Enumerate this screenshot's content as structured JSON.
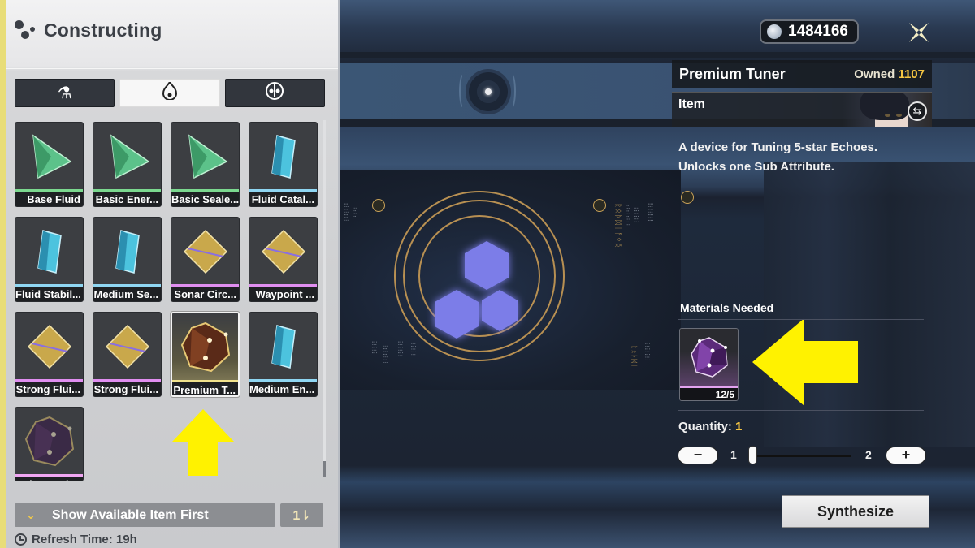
{
  "panel": {
    "title": "Constructing",
    "tabs": [
      {
        "icon": "flask-icon",
        "glyph": "⚗",
        "active": false
      },
      {
        "icon": "flame-icon",
        "glyph": "♨",
        "active": true
      },
      {
        "icon": "echo-mask-icon",
        "glyph": "◉",
        "active": false
      }
    ],
    "items": [
      {
        "name": "Base Fluid",
        "rarity": "green",
        "rarity_color": "#7bd88f"
      },
      {
        "name": "Basic Ener...",
        "rarity": "green",
        "rarity_color": "#7bd88f"
      },
      {
        "name": "Basic Seale...",
        "rarity": "green",
        "rarity_color": "#7bd88f"
      },
      {
        "name": "Fluid Catal...",
        "rarity": "blue",
        "rarity_color": "#8fd6f2"
      },
      {
        "name": "Fluid Stabil...",
        "rarity": "blue",
        "rarity_color": "#8fd6f2"
      },
      {
        "name": "Medium Se...",
        "rarity": "blue",
        "rarity_color": "#8fd6f2"
      },
      {
        "name": "Sonar Circ...",
        "rarity": "purple",
        "rarity_color": "#e08ef0"
      },
      {
        "name": "Waypoint ...",
        "rarity": "purple",
        "rarity_color": "#e08ef0"
      },
      {
        "name": "Strong Flui...",
        "rarity": "purple",
        "rarity_color": "#e08ef0"
      },
      {
        "name": "Strong Flui...",
        "rarity": "purple",
        "rarity_color": "#e08ef0"
      },
      {
        "name": "Premium T...",
        "rarity": "gold",
        "rarity_color": "#f1e28c",
        "selected": true
      },
      {
        "name": "Medium En...",
        "rarity": "blue",
        "rarity_color": "#8fd6f2"
      },
      {
        "name": "Advanced ...",
        "rarity": "purple",
        "rarity_color": "#f0a6f2"
      }
    ],
    "filter_label": "Show Available Item First",
    "sort_glyph": "1⇂",
    "refresh_label": "Refresh Time: 19h"
  },
  "header": {
    "currency_amount": "1484166",
    "close_icon": "close-icon"
  },
  "detail": {
    "item_name": "Premium Tuner",
    "owned_label": "Owned",
    "owned_count": "1107",
    "item_type": "Item",
    "description_line1": "A device for Tuning 5-star Echoes.",
    "description_line2": "Unlocks one Sub Attribute.",
    "materials_title": "Materials Needed",
    "materials": [
      {
        "name": "Advanced Tuner",
        "count": "12/5",
        "rarity_color": "#e3a3f0"
      }
    ],
    "quantity_label": "Quantity:",
    "quantity_value": "1",
    "slider_min": "1",
    "slider_max": "2",
    "slider_fraction": 0,
    "minus_label": "−",
    "plus_label": "+",
    "synthesize_label": "Synthesize"
  },
  "colors": {
    "accent_yellow": "#f5c542",
    "annotation_yellow": "#fff200"
  }
}
